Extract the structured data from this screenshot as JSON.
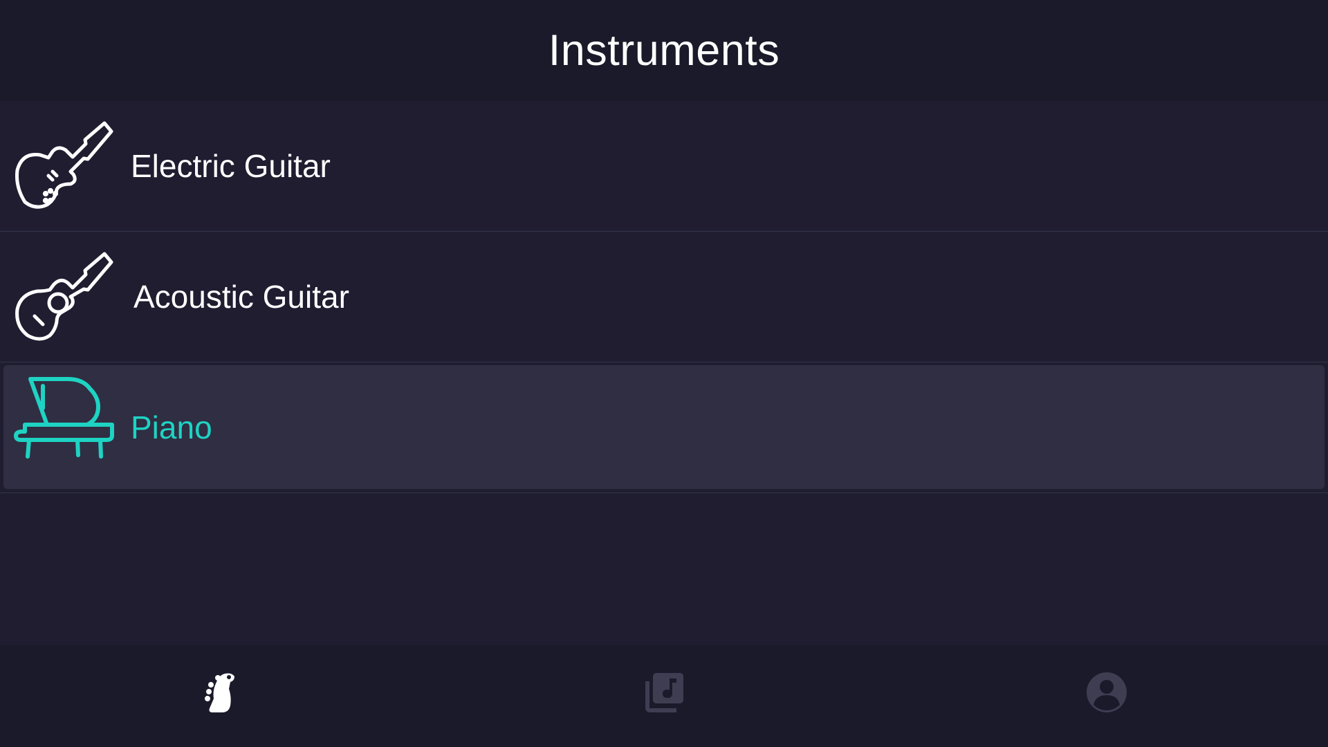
{
  "header": {
    "title": "Instruments"
  },
  "instruments": [
    {
      "label": "Electric Guitar",
      "icon": "electric-guitar-icon",
      "selected": false
    },
    {
      "label": "Acoustic Guitar",
      "icon": "acoustic-guitar-icon",
      "selected": false
    },
    {
      "label": "Piano",
      "icon": "piano-icon",
      "selected": true
    }
  ],
  "bottom_nav": [
    {
      "icon": "guitar-headstock-icon",
      "active": true
    },
    {
      "icon": "music-library-icon",
      "active": false
    },
    {
      "icon": "account-icon",
      "active": false
    }
  ],
  "colors": {
    "background": "#201d31",
    "bar": "#1a1a2a",
    "selected_row": "#302e42",
    "accent": "#1ed3c3",
    "text": "#ffffff",
    "inactive_icon": "#3e3d52"
  }
}
